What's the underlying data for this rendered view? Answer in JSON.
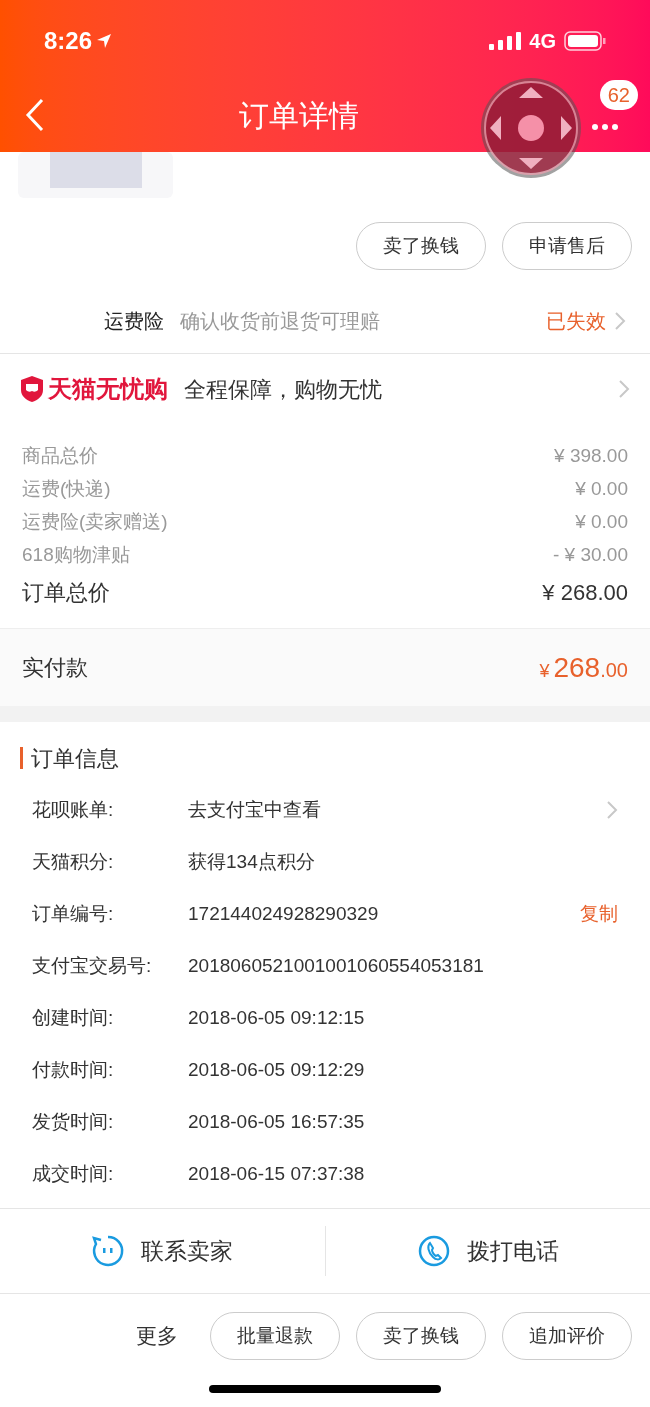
{
  "status_bar": {
    "time": "8:26",
    "network": "4G"
  },
  "header": {
    "title": "订单详情",
    "badge": "62"
  },
  "item_actions": [
    "卖了换钱",
    "申请售后"
  ],
  "freight_insurance": {
    "label": "运费险",
    "description": "确认收货前退货可理赔",
    "status": "已失效"
  },
  "guarantee": {
    "brand": "天猫无忧购",
    "text": "全程保障，购物无忧"
  },
  "price_lines": [
    {
      "label": "商品总价",
      "value": "¥ 398.00"
    },
    {
      "label": "运费(快递)",
      "value": "¥ 0.00"
    },
    {
      "label": "运费险(卖家赠送)",
      "value": "¥ 0.00"
    },
    {
      "label": "618购物津贴",
      "value": "- ¥ 30.00"
    }
  ],
  "order_total": {
    "label": "订单总价",
    "value": "¥ 268.00"
  },
  "paid": {
    "label": "实付款",
    "currency": "¥",
    "integer": "268",
    "decimal": ".00"
  },
  "order_info": {
    "title": "订单信息",
    "rows": [
      {
        "label": "花呗账单:",
        "value": "去支付宝中查看",
        "kind": "link"
      },
      {
        "label": "天猫积分:",
        "value": "获得134点积分",
        "kind": "plain"
      },
      {
        "label": "订单编号:",
        "value": "172144024928290329",
        "kind": "copy",
        "action": "复制"
      },
      {
        "label": "支付宝交易号:",
        "value": "2018060521001001060554053181",
        "kind": "plain"
      },
      {
        "label": "创建时间:",
        "value": "2018-06-05 09:12:15",
        "kind": "plain"
      },
      {
        "label": "付款时间:",
        "value": "2018-06-05 09:12:29",
        "kind": "plain"
      },
      {
        "label": "发货时间:",
        "value": "2018-06-05 16:57:35",
        "kind": "plain"
      },
      {
        "label": "成交时间:",
        "value": "2018-06-15 07:37:38",
        "kind": "plain"
      }
    ]
  },
  "contact": [
    {
      "label": "联系卖家",
      "kind": "chat"
    },
    {
      "label": "拨打电话",
      "kind": "phone"
    }
  ],
  "bottom_bar": {
    "more": "更多",
    "buttons": [
      "批量退款",
      "卖了换钱",
      "追加评价"
    ]
  }
}
